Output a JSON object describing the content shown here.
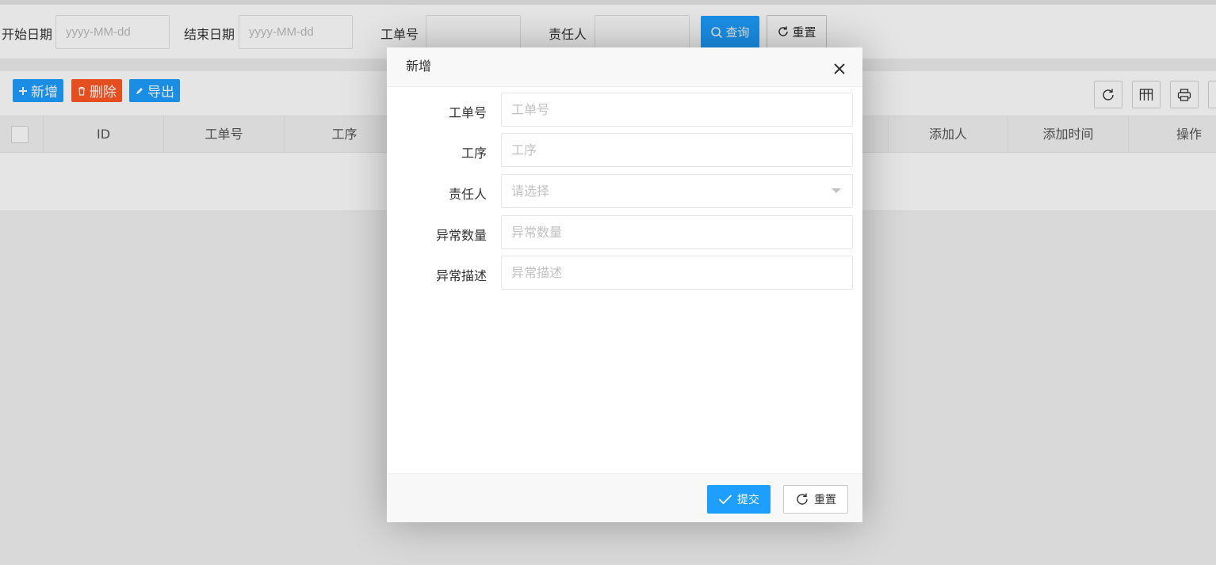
{
  "search": {
    "start_date_label": "开始日期",
    "start_date_placeholder": "yyyy-MM-dd",
    "end_date_label": "结束日期",
    "end_date_placeholder": "yyyy-MM-dd",
    "work_order_label": "工单号",
    "owner_label": "责任人",
    "query_label": "查询",
    "reset_label": "重置"
  },
  "toolbar": {
    "add_label": "新增",
    "delete_label": "删除",
    "export_label": "导出",
    "icons": [
      "refresh-icon",
      "columns-icon",
      "print-icon"
    ]
  },
  "table": {
    "columns_left": [
      "ID",
      "工单号",
      "工序"
    ],
    "columns_right": [
      "添加人",
      "添加时间",
      "操作"
    ]
  },
  "dialog": {
    "title": "新增",
    "fields": [
      {
        "label": "工单号",
        "placeholder": "工单号"
      },
      {
        "label": "工序",
        "placeholder": "工序"
      },
      {
        "label": "责任人",
        "placeholder": "请选择"
      },
      {
        "label": "异常数量",
        "placeholder": "异常数量"
      },
      {
        "label": "异常描述",
        "placeholder": "异常描述"
      }
    ],
    "submit_label": "提交",
    "reset_label": "重置"
  },
  "colors": {
    "primary": "#1e9fff",
    "danger": "#ff5722"
  }
}
